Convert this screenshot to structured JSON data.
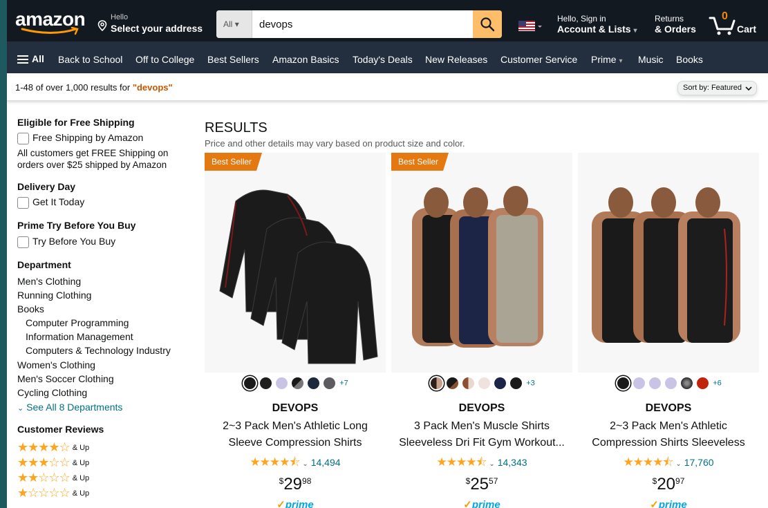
{
  "header": {
    "logo": "amazon",
    "address_hello": "Hello",
    "address_label": "Select your address",
    "search_category": "All",
    "search_value": "devops",
    "account_l1": "Hello, Sign in",
    "account_l2": "Account & Lists",
    "returns_l1": "Returns",
    "returns_l2": "& Orders",
    "cart_count": "0",
    "cart_label": "Cart"
  },
  "nav": {
    "all": "All",
    "items": [
      "Back to School",
      "Off to College",
      "Best Sellers",
      "Amazon Basics",
      "Today's Deals",
      "New Releases",
      "Customer Service",
      "Prime",
      "Music",
      "Books"
    ]
  },
  "results_bar": {
    "count_text": "1-48 of over 1,000 results for ",
    "query": "\"devops\"",
    "sort_label": "Sort by: Featured"
  },
  "sidebar": {
    "shipping_heading": "Eligible for Free Shipping",
    "shipping_option": "Free Shipping by Amazon",
    "shipping_note": "All customers get FREE Shipping on orders over $25 shipped by Amazon",
    "delivery_heading": "Delivery Day",
    "delivery_option": "Get It Today",
    "prime_heading": "Prime Try Before You Buy",
    "prime_option": "Try Before You Buy",
    "department_heading": "Department",
    "departments": [
      "Men's Clothing",
      "Running Clothing",
      "Books"
    ],
    "sub_departments": [
      "Computer Programming",
      "Information Management",
      "Computers & Technology Industry"
    ],
    "departments2": [
      "Women's Clothing",
      "Men's Soccer Clothing",
      "Cycling Clothing"
    ],
    "see_all": "See All 8 Departments",
    "reviews_heading": "Customer Reviews",
    "up_label": "& Up",
    "star_ratings": [
      4,
      3,
      2,
      1
    ]
  },
  "results": {
    "title": "RESULTS",
    "subtitle": "Price and other details may vary based on product size and color.",
    "products": [
      {
        "badge": "Best Seller",
        "brand": "DEVOPS",
        "title": "2~3 Pack Men's Athletic Long Sleeve Compression Shirts",
        "rating_count": "14,494",
        "price_symbol": "$",
        "price_whole": "29",
        "price_cents": "98",
        "prime": "prime",
        "more_colors": "+7",
        "colors": [
          "#1a1a1a",
          "#1f1f1f",
          "#c9c4e6",
          "#3a3a3a",
          "#1d2a3e",
          "#5b5b60"
        ]
      },
      {
        "badge": "Best Seller",
        "brand": "DEVOPS",
        "title": "3 Pack Men's Muscle Shirts Sleeveless Dri Fit Gym Workout...",
        "rating_count": "14,343",
        "price_symbol": "$",
        "price_whole": "25",
        "price_cents": "57",
        "prime": "prime",
        "more_colors": "+3",
        "colors": [
          "#2a1f1a",
          "#1a1a1a",
          "#8a5030",
          "#f0e2de",
          "#1c2545",
          "#1a1a1a"
        ]
      },
      {
        "badge": "",
        "brand": "DEVOPS",
        "title": "2~3 Pack Men's Athletic Compression Shirts Sleeveless",
        "rating_count": "17,760",
        "price_symbol": "$",
        "price_whole": "20",
        "price_cents": "97",
        "prime": "prime",
        "more_colors": "+6",
        "colors": [
          "#1a1a1a",
          "#c9c4e6",
          "#c9c4e6",
          "#c9c4e6",
          "#4a4a4a",
          "#c0250c"
        ]
      }
    ]
  },
  "colors": {
    "nav_top": "#131921",
    "nav_main": "#232f3e",
    "search_button": "#febd69",
    "badge": "#e47911",
    "star": "#ffa41c",
    "link": "#007185"
  }
}
